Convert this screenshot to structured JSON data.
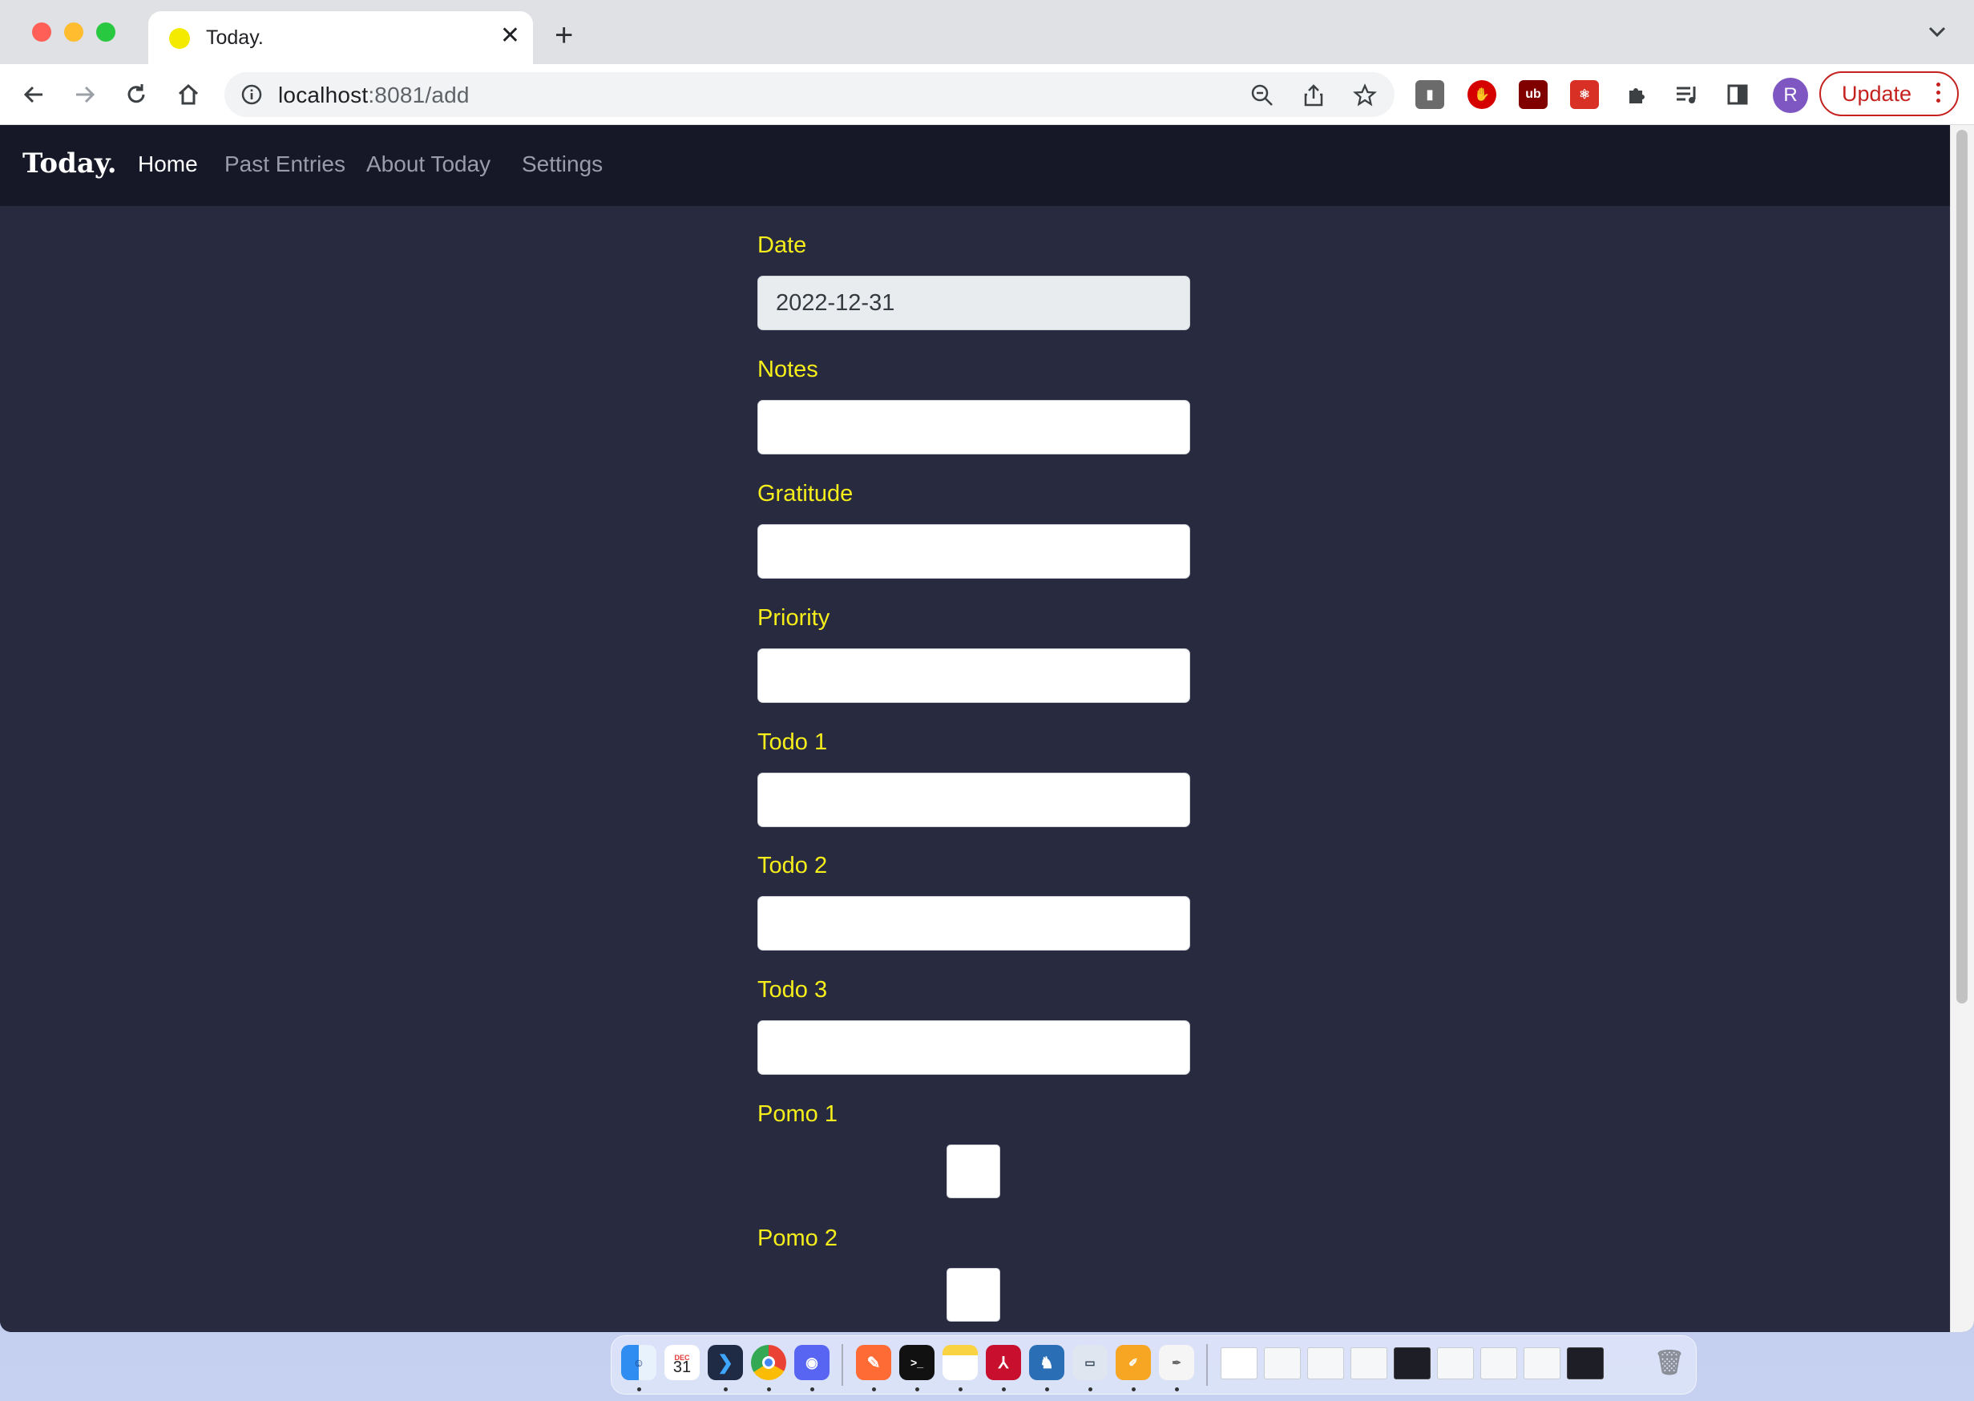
{
  "browser": {
    "tab_title": "Today.",
    "url_host": "localhost",
    "url_rest": ":8081/add",
    "update_label": "Update",
    "avatar_letter": "R"
  },
  "app": {
    "brand": "Today.",
    "nav": [
      {
        "label": "Home",
        "active": true
      },
      {
        "label": "Past Entries",
        "active": false
      },
      {
        "label": "About Today",
        "active": false
      },
      {
        "label": "Settings",
        "active": false
      }
    ]
  },
  "form": {
    "fields": [
      {
        "label": "Date",
        "value": "2022-12-31",
        "type": "text",
        "readonly": true
      },
      {
        "label": "Notes",
        "value": "",
        "type": "text"
      },
      {
        "label": "Gratitude",
        "value": "",
        "type": "text"
      },
      {
        "label": "Priority",
        "value": "",
        "type": "text"
      },
      {
        "label": "Todo 1",
        "value": "",
        "type": "text"
      },
      {
        "label": "Todo 2",
        "value": "",
        "type": "text"
      },
      {
        "label": "Todo 3",
        "value": "",
        "type": "text"
      },
      {
        "label": "Pomo 1",
        "type": "checkbox",
        "checked": false
      },
      {
        "label": "Pomo 2",
        "type": "checkbox",
        "checked": false
      }
    ]
  },
  "colors": {
    "page_bg": "#282a40",
    "navbar_bg": "#161827",
    "label_yellow": "#f5ee1b",
    "update_red": "#c5221f"
  },
  "dock": {
    "calendar_month": "DEC",
    "calendar_day": "31"
  }
}
